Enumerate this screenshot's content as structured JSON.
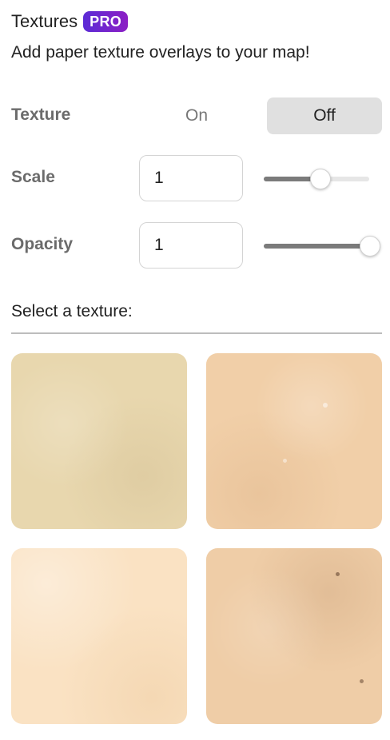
{
  "header": {
    "title": "Textures",
    "pro_badge": "PRO",
    "subtitle": "Add paper texture overlays to your map!"
  },
  "texture_toggle": {
    "label": "Texture",
    "on_label": "On",
    "off_label": "Off",
    "selected": "Off"
  },
  "scale": {
    "label": "Scale",
    "value": "1",
    "slider_fraction": 0.53
  },
  "opacity": {
    "label": "Opacity",
    "value": "1",
    "slider_fraction": 1.0
  },
  "texture_picker": {
    "title": "Select a texture:"
  },
  "colors": {
    "pro_badge_start": "#5b2bd6",
    "pro_badge_end": "#8c1fc4",
    "selected_segment_bg": "#e0e0e0",
    "slider_fill": "#7b7b7b",
    "texture_1": "#e8d7ae",
    "texture_2": "#f1cfa8",
    "texture_3": "#fae2c3",
    "texture_4": "#efcda7"
  }
}
